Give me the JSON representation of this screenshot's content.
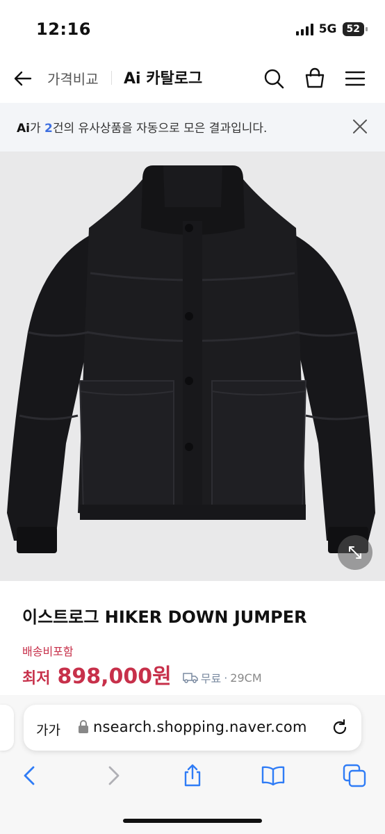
{
  "status_bar": {
    "time": "12:16",
    "network": "5G",
    "battery": "52"
  },
  "nav": {
    "crumb": "가격비교",
    "title_ai": "Ai",
    "title": "카탈로그",
    "icons": [
      "back-arrow-icon",
      "search-icon",
      "shopping-bag-icon",
      "menu-icon"
    ]
  },
  "ai_banner": {
    "mark": "Ai",
    "prefix": "가 ",
    "count": "2",
    "suffix": "건의 유사상품을 자동으로 모은 결과입니다."
  },
  "product": {
    "title": "이스트로그 HIKER DOWN JUMPER",
    "shipping_label": "배송비포함",
    "price_prefix": "최저",
    "price": "898,000원",
    "shipping": "무료",
    "seller": "29CM",
    "image": "black-down-jumper"
  },
  "browser": {
    "text_size": "가가",
    "url": "nsearch.shopping.naver.com",
    "toolbar": [
      "back-icon",
      "forward-icon",
      "share-icon",
      "bookmarks-icon",
      "tabs-icon"
    ]
  },
  "colors": {
    "price_red": "#c7304a",
    "ai_blue": "#3e6fe0",
    "banner_bg": "#f3f5f8"
  }
}
